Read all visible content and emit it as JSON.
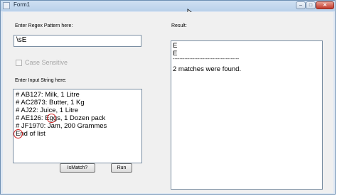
{
  "window": {
    "title": "Form1",
    "minimize_glyph": "–",
    "maximize_glyph": "□",
    "close_glyph": "✕"
  },
  "left_panel": {
    "regex_label": "Enter Regex Pattern here:",
    "regex_value": "\\sE",
    "case_sensitive_label": "Case Sensitive",
    "case_sensitive_checked": false,
    "input_label": "Enter Input String here:",
    "input_lines": [
      "# AB127: Milk, 1 Litre",
      "# AC2873: Butter, 1 Kg",
      "# AJ22: Juice, 1 Litre",
      "# AE126: Eggs, 1 Dozen pack",
      "# JF1970: Jam, 200 Grammes",
      "End of list"
    ]
  },
  "right_panel": {
    "result_label": "Result:",
    "result_lines": [
      " E",
      "E",
      "----------------------------------------",
      "2 matches were found."
    ]
  },
  "buttons": {
    "ismatch_label": "IsMatch?",
    "run_label": "Run"
  },
  "colors": {
    "annotation_circle": "#d02020",
    "disabled_text": "#a6a6a6"
  }
}
